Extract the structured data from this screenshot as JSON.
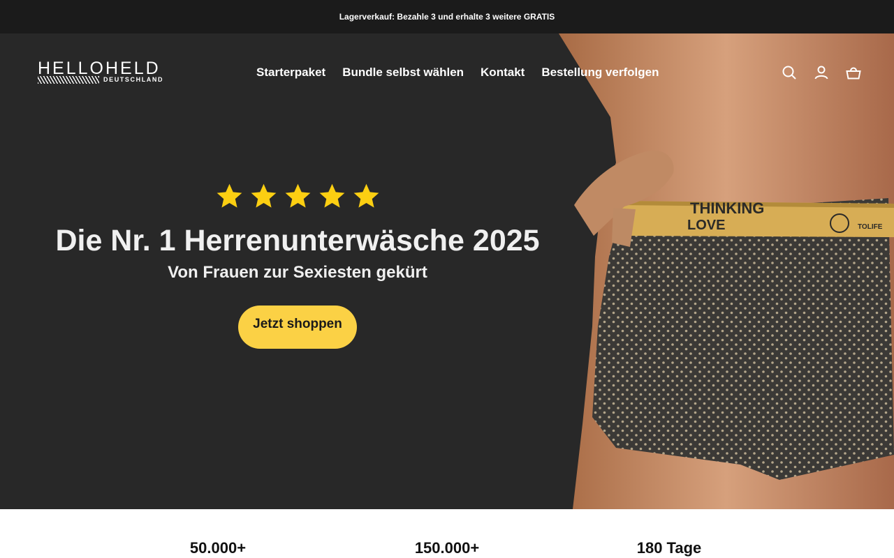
{
  "announcement": {
    "text": "Lagerverkauf: Bezahle 3 und erhalte 3 weitere GRATIS"
  },
  "header": {
    "logo_main": "HELLOHELD",
    "logo_sub": "DEUTSCHLAND",
    "nav": [
      "Starterpaket",
      "Bundle selbst wählen",
      "Kontakt",
      "Bestellung verfolgen"
    ],
    "icons": [
      "search-icon",
      "account-icon",
      "cart-icon"
    ]
  },
  "hero": {
    "rating_stars": 5,
    "headline": "Die Nr. 1 Herrenunterwäsche 2025",
    "subline": "Von Frauen zur Sexiesten gekürt",
    "cta_label": "Jetzt shoppen",
    "waistband_line1": "THINKING",
    "waistband_line2": "LOVE",
    "waistband_brand": "TOLIFE",
    "colors": {
      "background": "#282828",
      "accent": "#fbd145",
      "star": "#fccf12"
    }
  },
  "stats": [
    "50.000+",
    "150.000+",
    "180 Tage"
  ]
}
